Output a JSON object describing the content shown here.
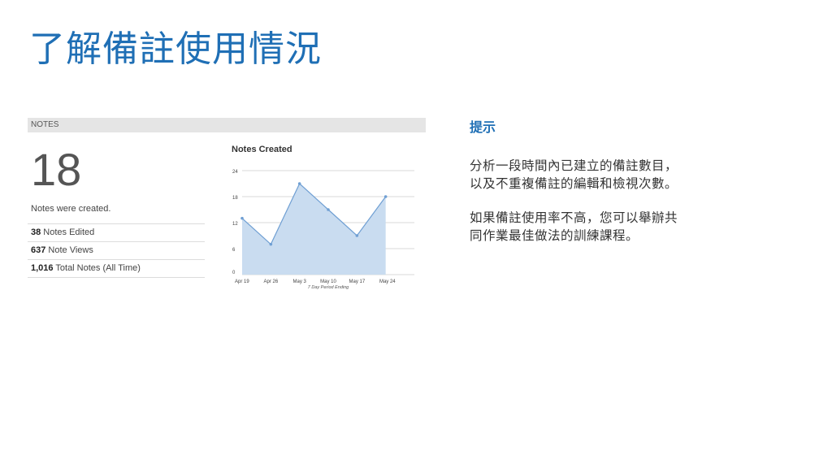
{
  "slide": {
    "title": "了解備註使用情況"
  },
  "notes": {
    "header": "NOTES",
    "count": "18",
    "count_caption": "Notes were created.",
    "stats": [
      {
        "value": "38",
        "label": " Notes Edited"
      },
      {
        "value": "637",
        "label": " Note Views"
      },
      {
        "value": "1,016",
        "label": " Total Notes (All Time)"
      }
    ]
  },
  "chart_data": {
    "type": "area",
    "title": "Notes Created",
    "xlabel": "7 Day Period Ending",
    "ylabel": "",
    "categories": [
      "Apr 19",
      "Apr 26",
      "May 3",
      "May 10",
      "May 17",
      "May 24"
    ],
    "x": [
      0,
      1,
      2,
      3,
      4,
      5,
      6
    ],
    "values": [
      13,
      7,
      21,
      15,
      9,
      18
    ],
    "ylim": [
      0,
      24
    ],
    "yticks": [
      "0",
      "6",
      "12",
      "18",
      "24"
    ],
    "grid": true,
    "colors": {
      "line": "#6f9fd3",
      "fill": "#c9dcf0",
      "grid": "#d8d8d8"
    }
  },
  "tip": {
    "heading": "提示",
    "paragraphs": [
      "分析一段時間內已建立的備註數目，\n以及不重複備註的編輯和檢視次數。",
      "如果備註使用率不高，您可以舉辦共\n同作業最佳做法的訓練課程。"
    ]
  }
}
